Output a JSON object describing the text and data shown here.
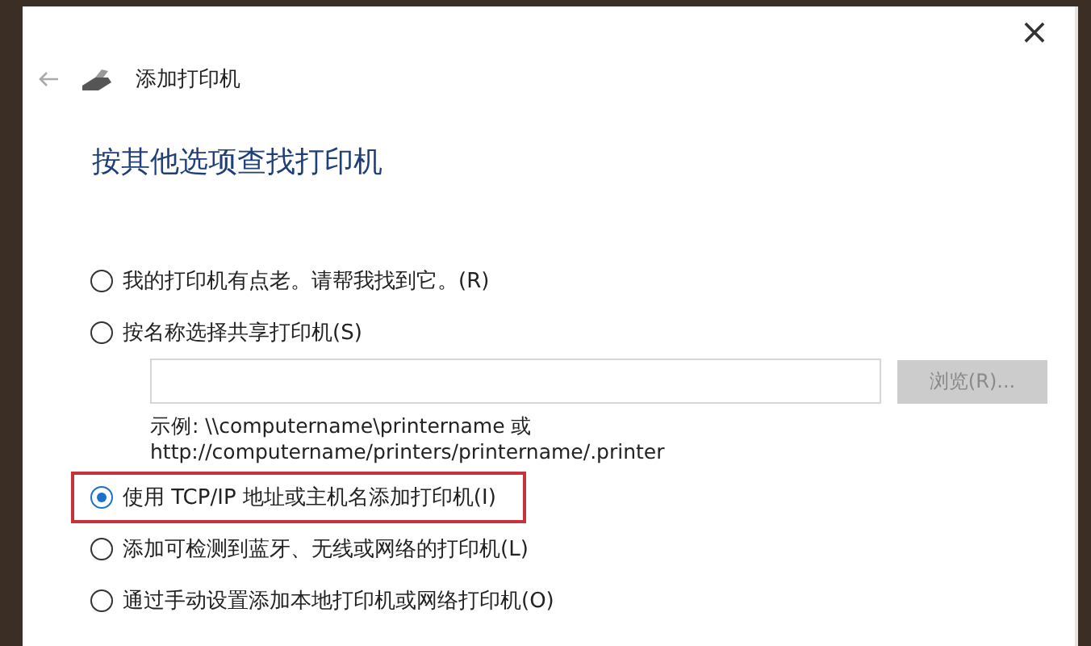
{
  "window": {
    "title": "添加打印机",
    "close": "×"
  },
  "heading": "按其他选项查找打印机",
  "options": [
    {
      "label": "我的打印机有点老。请帮我找到它。(R)",
      "selected": false,
      "highlighted": false
    },
    {
      "label": "按名称选择共享打印机(S)",
      "selected": false,
      "highlighted": false,
      "path_input": {
        "browse_button": {
          "label": "浏览(R)...",
          "disabled": true
        },
        "example": [
          "示例: \\\\computername\\printername 或",
          "http://computername/printers/printername/.printer"
        ]
      }
    },
    {
      "label": "使用 TCP/IP 地址或主机名添加打印机(I)",
      "selected": true,
      "highlighted": true
    },
    {
      "label": "添加可检测到蓝牙、无线或网络的打印机(L)",
      "selected": false,
      "highlighted": false
    },
    {
      "label": "通过手动设置添加本地打印机或网络打印机(O)",
      "selected": false,
      "highlighted": false
    }
  ]
}
